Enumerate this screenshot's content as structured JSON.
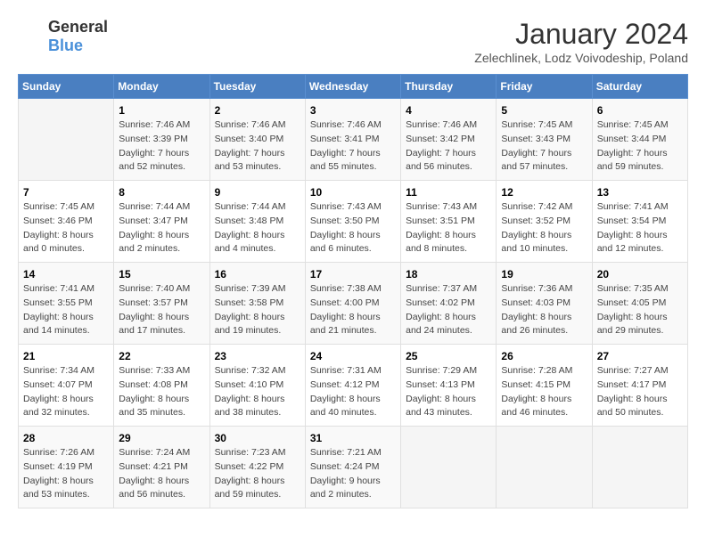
{
  "header": {
    "logo_line1": "General",
    "logo_line2": "Blue",
    "month": "January 2024",
    "location": "Zelechlinek, Lodz Voivodeship, Poland"
  },
  "weekdays": [
    "Sunday",
    "Monday",
    "Tuesday",
    "Wednesday",
    "Thursday",
    "Friday",
    "Saturday"
  ],
  "weeks": [
    [
      {
        "day": "",
        "info": ""
      },
      {
        "day": "1",
        "sunrise": "7:46 AM",
        "sunset": "3:39 PM",
        "daylight": "7 hours and 52 minutes."
      },
      {
        "day": "2",
        "sunrise": "7:46 AM",
        "sunset": "3:40 PM",
        "daylight": "7 hours and 53 minutes."
      },
      {
        "day": "3",
        "sunrise": "7:46 AM",
        "sunset": "3:41 PM",
        "daylight": "7 hours and 55 minutes."
      },
      {
        "day": "4",
        "sunrise": "7:46 AM",
        "sunset": "3:42 PM",
        "daylight": "7 hours and 56 minutes."
      },
      {
        "day": "5",
        "sunrise": "7:45 AM",
        "sunset": "3:43 PM",
        "daylight": "7 hours and 57 minutes."
      },
      {
        "day": "6",
        "sunrise": "7:45 AM",
        "sunset": "3:44 PM",
        "daylight": "7 hours and 59 minutes."
      }
    ],
    [
      {
        "day": "7",
        "sunrise": "7:45 AM",
        "sunset": "3:46 PM",
        "daylight": "8 hours and 0 minutes."
      },
      {
        "day": "8",
        "sunrise": "7:44 AM",
        "sunset": "3:47 PM",
        "daylight": "8 hours and 2 minutes."
      },
      {
        "day": "9",
        "sunrise": "7:44 AM",
        "sunset": "3:48 PM",
        "daylight": "8 hours and 4 minutes."
      },
      {
        "day": "10",
        "sunrise": "7:43 AM",
        "sunset": "3:50 PM",
        "daylight": "8 hours and 6 minutes."
      },
      {
        "day": "11",
        "sunrise": "7:43 AM",
        "sunset": "3:51 PM",
        "daylight": "8 hours and 8 minutes."
      },
      {
        "day": "12",
        "sunrise": "7:42 AM",
        "sunset": "3:52 PM",
        "daylight": "8 hours and 10 minutes."
      },
      {
        "day": "13",
        "sunrise": "7:41 AM",
        "sunset": "3:54 PM",
        "daylight": "8 hours and 12 minutes."
      }
    ],
    [
      {
        "day": "14",
        "sunrise": "7:41 AM",
        "sunset": "3:55 PM",
        "daylight": "8 hours and 14 minutes."
      },
      {
        "day": "15",
        "sunrise": "7:40 AM",
        "sunset": "3:57 PM",
        "daylight": "8 hours and 17 minutes."
      },
      {
        "day": "16",
        "sunrise": "7:39 AM",
        "sunset": "3:58 PM",
        "daylight": "8 hours and 19 minutes."
      },
      {
        "day": "17",
        "sunrise": "7:38 AM",
        "sunset": "4:00 PM",
        "daylight": "8 hours and 21 minutes."
      },
      {
        "day": "18",
        "sunrise": "7:37 AM",
        "sunset": "4:02 PM",
        "daylight": "8 hours and 24 minutes."
      },
      {
        "day": "19",
        "sunrise": "7:36 AM",
        "sunset": "4:03 PM",
        "daylight": "8 hours and 26 minutes."
      },
      {
        "day": "20",
        "sunrise": "7:35 AM",
        "sunset": "4:05 PM",
        "daylight": "8 hours and 29 minutes."
      }
    ],
    [
      {
        "day": "21",
        "sunrise": "7:34 AM",
        "sunset": "4:07 PM",
        "daylight": "8 hours and 32 minutes."
      },
      {
        "day": "22",
        "sunrise": "7:33 AM",
        "sunset": "4:08 PM",
        "daylight": "8 hours and 35 minutes."
      },
      {
        "day": "23",
        "sunrise": "7:32 AM",
        "sunset": "4:10 PM",
        "daylight": "8 hours and 38 minutes."
      },
      {
        "day": "24",
        "sunrise": "7:31 AM",
        "sunset": "4:12 PM",
        "daylight": "8 hours and 40 minutes."
      },
      {
        "day": "25",
        "sunrise": "7:29 AM",
        "sunset": "4:13 PM",
        "daylight": "8 hours and 43 minutes."
      },
      {
        "day": "26",
        "sunrise": "7:28 AM",
        "sunset": "4:15 PM",
        "daylight": "8 hours and 46 minutes."
      },
      {
        "day": "27",
        "sunrise": "7:27 AM",
        "sunset": "4:17 PM",
        "daylight": "8 hours and 50 minutes."
      }
    ],
    [
      {
        "day": "28",
        "sunrise": "7:26 AM",
        "sunset": "4:19 PM",
        "daylight": "8 hours and 53 minutes."
      },
      {
        "day": "29",
        "sunrise": "7:24 AM",
        "sunset": "4:21 PM",
        "daylight": "8 hours and 56 minutes."
      },
      {
        "day": "30",
        "sunrise": "7:23 AM",
        "sunset": "4:22 PM",
        "daylight": "8 hours and 59 minutes."
      },
      {
        "day": "31",
        "sunrise": "7:21 AM",
        "sunset": "4:24 PM",
        "daylight": "9 hours and 2 minutes."
      },
      {
        "day": "",
        "info": ""
      },
      {
        "day": "",
        "info": ""
      },
      {
        "day": "",
        "info": ""
      }
    ]
  ],
  "labels": {
    "sunrise": "Sunrise:",
    "sunset": "Sunset:",
    "daylight": "Daylight:"
  }
}
